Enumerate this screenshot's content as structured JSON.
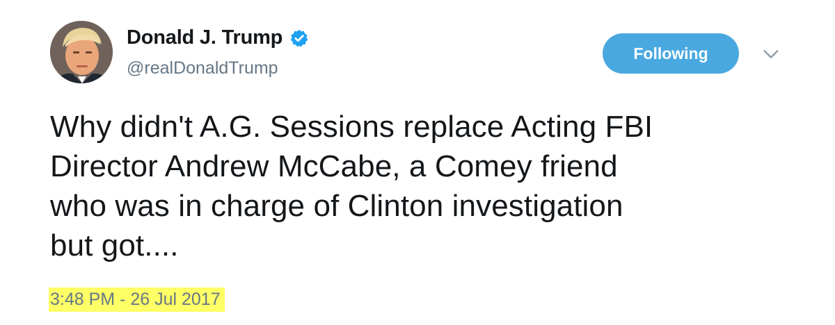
{
  "user": {
    "display_name": "Donald J. Trump",
    "handle": "@realDonaldTrump",
    "verified": true,
    "verified_icon": "verified-badge-icon",
    "avatar_icon": "profile-avatar"
  },
  "follow_button": {
    "label": "Following"
  },
  "menu_caret_icon": "chevron-down-icon",
  "tweet": {
    "lines": [
      "Why didn't A.G. Sessions replace Acting FBI",
      "Director Andrew McCabe, a Comey friend",
      "who was in charge of Clinton investigation",
      "but got...."
    ],
    "timestamp": "3:48 PM - 26 Jul 2017"
  },
  "colors": {
    "accent": "#4aa8e0",
    "verified": "#1da1f2",
    "secondary_text": "#657786",
    "highlight": "#ffff66"
  }
}
